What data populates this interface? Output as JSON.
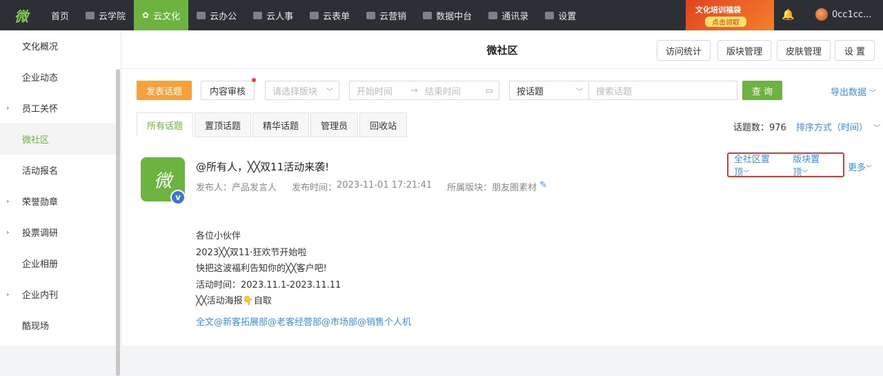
{
  "topnav": {
    "logo": "微",
    "items": [
      {
        "label": "首页",
        "icon": "home-icon",
        "active": false
      },
      {
        "label": "云学院",
        "icon": "video-icon",
        "active": false
      },
      {
        "label": "云文化",
        "icon": "gear-flower-icon",
        "active": true
      },
      {
        "label": "云办公",
        "icon": "briefcase-icon",
        "active": false
      },
      {
        "label": "云人事",
        "icon": "people-icon",
        "active": false
      },
      {
        "label": "云表单",
        "icon": "form-icon",
        "active": false
      },
      {
        "label": "云营销",
        "icon": "chart-icon",
        "active": false
      },
      {
        "label": "数据中台",
        "icon": "cube-icon",
        "active": false
      },
      {
        "label": "通讯录",
        "icon": "contact-icon",
        "active": false
      },
      {
        "label": "设置",
        "icon": "grid-icon",
        "active": false
      }
    ],
    "banner_line1": "文化培训福袋",
    "banner_line2": "点击领取",
    "username": "0cc1cc..."
  },
  "sidebar": {
    "items": [
      {
        "label": "文化概况",
        "expandable": false,
        "active": false
      },
      {
        "label": "企业动态",
        "expandable": false,
        "active": false
      },
      {
        "label": "员工关怀",
        "expandable": true,
        "active": false
      },
      {
        "label": "微社区",
        "expandable": false,
        "active": true
      },
      {
        "label": "活动报名",
        "expandable": false,
        "active": false
      },
      {
        "label": "荣誉勋章",
        "expandable": true,
        "active": false
      },
      {
        "label": "投票调研",
        "expandable": true,
        "active": false
      },
      {
        "label": "企业相册",
        "expandable": false,
        "active": false
      },
      {
        "label": "企业内刊",
        "expandable": true,
        "active": false
      },
      {
        "label": "酷现场",
        "expandable": false,
        "active": false
      }
    ]
  },
  "header": {
    "title": "微社区",
    "buttons": [
      "访问统计",
      "版块管理",
      "皮肤管理",
      "设 置"
    ]
  },
  "toolbar": {
    "post_label": "发表话题",
    "audit_label": "内容审核",
    "section_placeholder": "请选择版块",
    "start_placeholder": "开始时间",
    "end_placeholder": "结束时间",
    "search_type": "按话题",
    "search_placeholder": "搜索话题",
    "query_label": "查 询",
    "export_label": "导出数据"
  },
  "tabs": [
    "所有话题",
    "置顶话题",
    "精华话题",
    "管理员",
    "回收站"
  ],
  "stats": {
    "count_label": "话题数：",
    "count_value": "976",
    "sort_label": "排序方式（时间）"
  },
  "post": {
    "avatar_text": "微",
    "badge": "v",
    "title": "@所有人，╳╳双11活动来袭!",
    "author_label": "发布人：",
    "author": "产品发言人",
    "time_label": "发布时间：",
    "time": "2023-11-01 17:21:41",
    "section_label": "所属版块：",
    "section": "朋友圈素材",
    "actions": [
      "全社区置顶",
      "版块置顶"
    ],
    "more_label": "更多",
    "body": [
      "各位小伙伴",
      "2023╳╳双11·狂欢节开始啦",
      "快把这波福利告知你的╳╳客户吧!",
      "活动时间：2023.11.1-2023.11.11",
      "╳╳活动海报👇自取"
    ],
    "mention_line": "全文@新客拓展部@老客经营部@市场部@销售个人机"
  }
}
